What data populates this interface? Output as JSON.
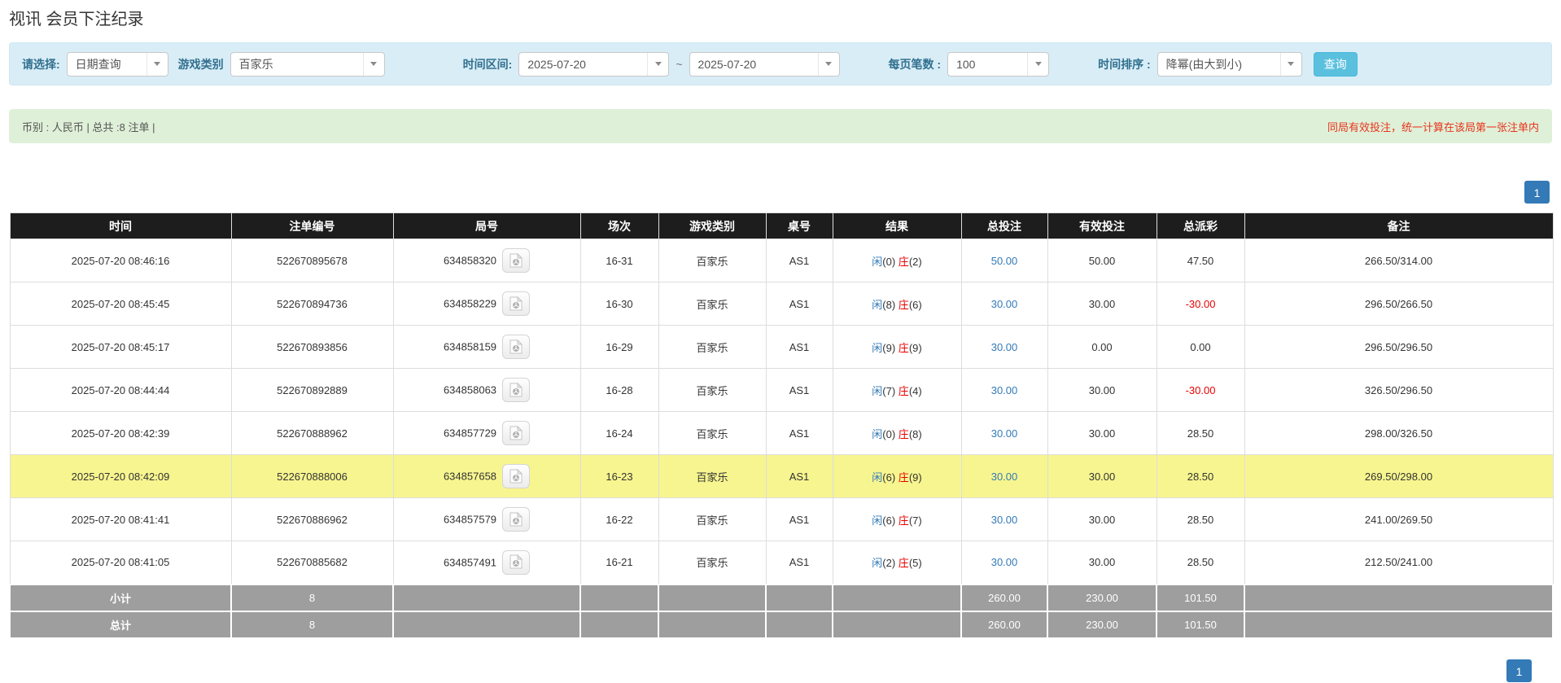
{
  "title": "视讯 会员下注纪录",
  "filter": {
    "select_label": "请选择:",
    "select_value": "日期查询",
    "game_type_label": "游戏类别",
    "game_type_value": "百家乐",
    "time_range_label": "时间区间:",
    "date_from": "2025-07-20",
    "tilde": "~",
    "date_to": "2025-07-20",
    "page_size_label": "每页笔数 :",
    "page_size_value": "100",
    "sort_label": "时间排序 :",
    "sort_value": "降幂(由大到小)",
    "search_button": "查询"
  },
  "summary": {
    "left": "币别 : 人民币 | 总共 :8 注单 |",
    "right": "同局有效投注，统一计算在该局第一张注单内"
  },
  "pagination": {
    "page": "1"
  },
  "table": {
    "headers": [
      "时间",
      "注单编号",
      "局号",
      "场次",
      "游戏类别",
      "桌号",
      "结果",
      "总投注",
      "有效投注",
      "总派彩",
      "备注"
    ],
    "rows": [
      {
        "time": "2025-07-20 08:46:16",
        "bet_id": "522670895678",
        "round_id": "634858320",
        "session": "16-31",
        "game": "百家乐",
        "table_no": "AS1",
        "result": {
          "player_label": "闲",
          "player_score": "(0)",
          "banker_label": "庄",
          "banker_score": "(2)"
        },
        "total_bet": "50.00",
        "valid_bet": "50.00",
        "payout": "47.50",
        "remark": "266.50/314.00",
        "highlight": false
      },
      {
        "time": "2025-07-20 08:45:45",
        "bet_id": "522670894736",
        "round_id": "634858229",
        "session": "16-30",
        "game": "百家乐",
        "table_no": "AS1",
        "result": {
          "player_label": "闲",
          "player_score": "(8)",
          "banker_label": "庄",
          "banker_score": "(6)"
        },
        "total_bet": "30.00",
        "valid_bet": "30.00",
        "payout": "-30.00",
        "remark": "296.50/266.50",
        "highlight": false
      },
      {
        "time": "2025-07-20 08:45:17",
        "bet_id": "522670893856",
        "round_id": "634858159",
        "session": "16-29",
        "game": "百家乐",
        "table_no": "AS1",
        "result": {
          "player_label": "闲",
          "player_score": "(9)",
          "banker_label": "庄",
          "banker_score": "(9)"
        },
        "total_bet": "30.00",
        "valid_bet": "0.00",
        "payout": "0.00",
        "remark": "296.50/296.50",
        "highlight": false
      },
      {
        "time": "2025-07-20 08:44:44",
        "bet_id": "522670892889",
        "round_id": "634858063",
        "session": "16-28",
        "game": "百家乐",
        "table_no": "AS1",
        "result": {
          "player_label": "闲",
          "player_score": "(7)",
          "banker_label": "庄",
          "banker_score": "(4)"
        },
        "total_bet": "30.00",
        "valid_bet": "30.00",
        "payout": "-30.00",
        "remark": "326.50/296.50",
        "highlight": false
      },
      {
        "time": "2025-07-20 08:42:39",
        "bet_id": "522670888962",
        "round_id": "634857729",
        "session": "16-24",
        "game": "百家乐",
        "table_no": "AS1",
        "result": {
          "player_label": "闲",
          "player_score": "(0)",
          "banker_label": "庄",
          "banker_score": "(8)"
        },
        "total_bet": "30.00",
        "valid_bet": "30.00",
        "payout": "28.50",
        "remark": "298.00/326.50",
        "highlight": false
      },
      {
        "time": "2025-07-20 08:42:09",
        "bet_id": "522670888006",
        "round_id": "634857658",
        "session": "16-23",
        "game": "百家乐",
        "table_no": "AS1",
        "result": {
          "player_label": "闲",
          "player_score": "(6)",
          "banker_label": "庄",
          "banker_score": "(9)"
        },
        "total_bet": "30.00",
        "valid_bet": "30.00",
        "payout": "28.50",
        "remark": "269.50/298.00",
        "highlight": true
      },
      {
        "time": "2025-07-20 08:41:41",
        "bet_id": "522670886962",
        "round_id": "634857579",
        "session": "16-22",
        "game": "百家乐",
        "table_no": "AS1",
        "result": {
          "player_label": "闲",
          "player_score": "(6)",
          "banker_label": "庄",
          "banker_score": "(7)"
        },
        "total_bet": "30.00",
        "valid_bet": "30.00",
        "payout": "28.50",
        "remark": "241.00/269.50",
        "highlight": false
      },
      {
        "time": "2025-07-20 08:41:05",
        "bet_id": "522670885682",
        "round_id": "634857491",
        "session": "16-21",
        "game": "百家乐",
        "table_no": "AS1",
        "result": {
          "player_label": "闲",
          "player_score": "(2)",
          "banker_label": "庄",
          "banker_score": "(5)"
        },
        "total_bet": "30.00",
        "valid_bet": "30.00",
        "payout": "28.50",
        "remark": "212.50/241.00",
        "highlight": false
      }
    ],
    "footer": [
      {
        "label": "小计",
        "count": "8",
        "total_bet": "260.00",
        "valid_bet": "230.00",
        "payout": "101.50"
      },
      {
        "label": "总计",
        "count": "8",
        "total_bet": "260.00",
        "valid_bet": "230.00",
        "payout": "101.50"
      }
    ]
  },
  "colors": {
    "header_bg": "#1d1d1d",
    "highlight_row": "#f7f58f",
    "footer_bg": "#9e9e9e",
    "filter_bg": "#d9edf7",
    "summary_bg": "#dff0d8",
    "search_button_bg": "#5bc0de",
    "pagination_active": "#337ab7",
    "link_blue": "#337ab7",
    "player_blue": "#337ab7",
    "banker_red": "#e60000",
    "negative_red": "#e60000",
    "note_red": "#e8341c"
  }
}
